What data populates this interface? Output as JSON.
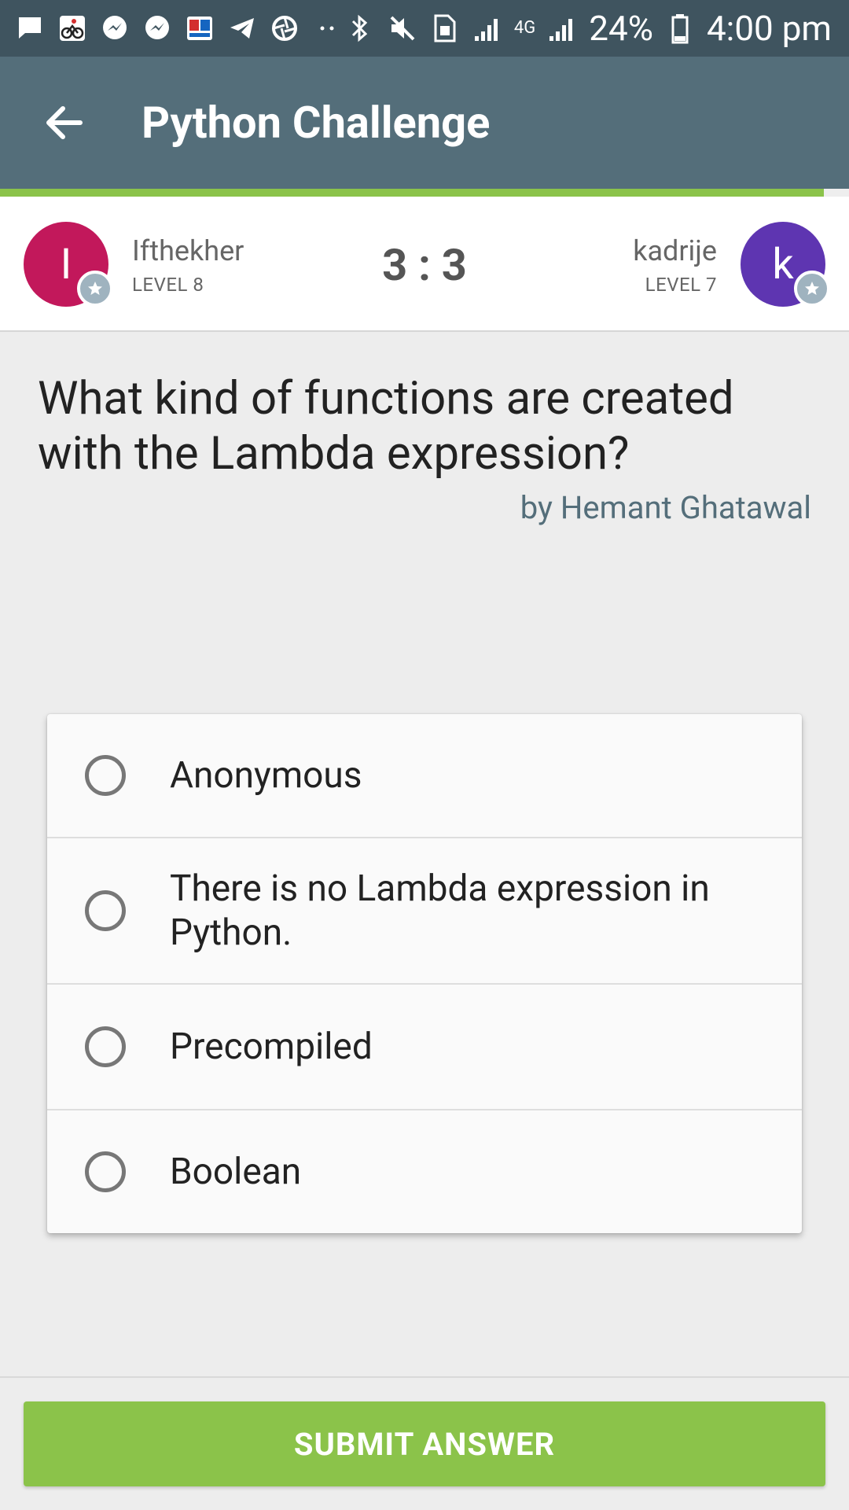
{
  "status_bar": {
    "battery": "24%",
    "time": "4:00 pm",
    "network": "4G",
    "left_icons": [
      "message-icon",
      "cycling-app-icon",
      "messenger-icon",
      "messenger-icon",
      "dictionary-app-icon",
      "telegram-icon",
      "aperture-icon",
      "dots-icon"
    ],
    "right_icons": [
      "bluetooth-icon",
      "mute-icon",
      "sim-icon",
      "signal-icon",
      "signal-icon",
      "battery-icon"
    ]
  },
  "appbar": {
    "title": "Python Challenge",
    "back_icon": "arrow-back-icon"
  },
  "progress": {
    "value": 0.97,
    "color": "#8bc34a"
  },
  "players": {
    "left": {
      "initial": "I",
      "name": "Ifthekher",
      "level": "LEVEL 8",
      "color": "#c2185b"
    },
    "right": {
      "initial": "k",
      "name": "kadrije",
      "level": "LEVEL 7",
      "color": "#5e35b1"
    },
    "score": "3 : 3"
  },
  "question": {
    "text": "What kind of functions are created with the Lambda expression?",
    "author": "by Hemant Ghatawal"
  },
  "options": [
    {
      "label": "Anonymous"
    },
    {
      "label": "There is no Lambda expression in Python."
    },
    {
      "label": "Precompiled"
    },
    {
      "label": "Boolean"
    }
  ],
  "submit": {
    "label": "SUBMIT ANSWER",
    "color": "#8bc34a"
  },
  "colors": {
    "status_bar": "#3f545f",
    "app_bar": "#546e7a",
    "background": "#ededed",
    "author": "#546e7a"
  }
}
